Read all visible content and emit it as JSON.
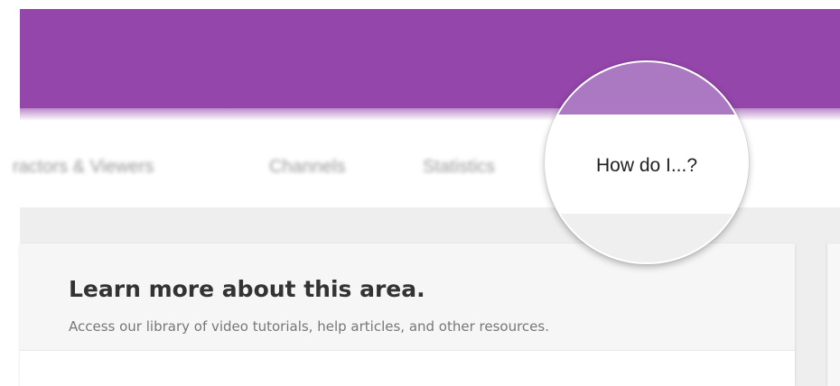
{
  "header": {
    "bar_color": "#9446aa"
  },
  "nav": {
    "items": [
      {
        "label": "ractors & Viewers"
      },
      {
        "label": "Channels"
      },
      {
        "label": "Statistics"
      }
    ],
    "highlighted": {
      "label": "How do I...?",
      "accent_color": "#ab78c2"
    }
  },
  "card": {
    "title": "Learn more about this area.",
    "subtitle": "Access our library of video tutorials, help articles, and other resources."
  }
}
